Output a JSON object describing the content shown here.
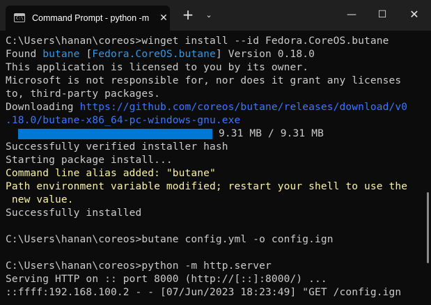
{
  "tab": {
    "title": "Command Prompt - python  -m",
    "icon": "cmd-icon",
    "close": "✕"
  },
  "titlebar": {
    "new_tab": "+",
    "dropdown": "⌄",
    "minimize": "—",
    "maximize": "☐",
    "close": "✕"
  },
  "terminal": {
    "l1": "C:\\Users\\hanan\\coreos>winget install --id Fedora.CoreOS.butane",
    "l2_a": "Found ",
    "l2_b": "butane",
    "l2_c": " [",
    "l2_d": "Fedora.CoreOS.butane",
    "l2_e": "] Version 0.18.0",
    "l3": "This application is licensed to you by its owner.",
    "l4": "Microsoft is not responsible for, nor does it grant any licenses",
    "l5": "to, third-party packages.",
    "l6_a": "Downloading ",
    "l6_b": "https://github.com/coreos/butane/releases/download/v0",
    "l7": ".18.0/butane-x86_64-pc-windows-gnu.exe",
    "progress_text": "9.31 MB / 9.31 MB",
    "progress_fraction": 1.0,
    "l9": "Successfully verified installer hash",
    "l10": "Starting package install...",
    "l11": "Command line alias added: \"butane\"",
    "l12": "Path environment variable modified; restart your shell to use the",
    "l13": " new value.",
    "l14": "Successfully installed",
    "l16": "C:\\Users\\hanan\\coreos>butane config.yml -o config.ign",
    "l18": "C:\\Users\\hanan\\coreos>python -m http.server",
    "l19": "Serving HTTP on :: port 8000 (http://[::]:8000/) ...",
    "l20": "::ffff:192.168.100.2 - - [07/Jun/2023 18:23:49] \"GET /config.ign"
  },
  "colors": {
    "background": "#0c0c0c",
    "text": "#cccccc",
    "cyan": "#3a96dd",
    "link": "#3b78ff",
    "warning": "#f9f1a5",
    "progress": "#0078d4"
  }
}
